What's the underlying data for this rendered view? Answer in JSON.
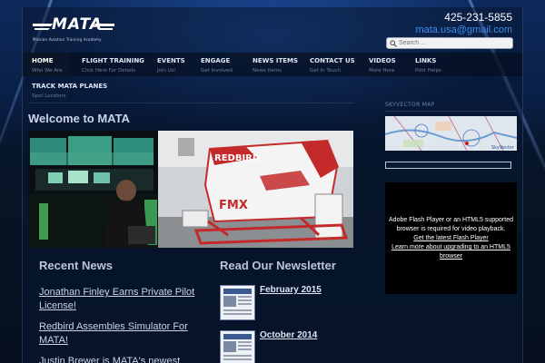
{
  "header": {
    "logo_text": "MATA",
    "logo_subtitle": "Mission Aviation Training Academy",
    "phone": "425-231-5855",
    "email": "mata.usa@gmail.com"
  },
  "search": {
    "placeholder": "Search ..."
  },
  "nav": {
    "items": [
      {
        "label": "HOME",
        "sub": "Who We Are",
        "active": true
      },
      {
        "label": "FLIGHT TRAINING",
        "sub": "Click Here For Details"
      },
      {
        "label": "EVENTS",
        "sub": "Join Us!"
      },
      {
        "label": "ENGAGE",
        "sub": "Get Involved"
      },
      {
        "label": "NEWS ITEMS",
        "sub": "News Items"
      },
      {
        "label": "CONTACT US",
        "sub": "Get In Touch"
      },
      {
        "label": "VIDEOS",
        "sub": "More Here"
      },
      {
        "label": "LINKS",
        "sub": "Pilot Helps"
      },
      {
        "label": "TRACK MATA PLANES",
        "sub": "Spot Locators"
      }
    ]
  },
  "main": {
    "welcome": "Welcome to MATA",
    "hero_brand": "REDBIRD",
    "hero_model": "FMX"
  },
  "news": {
    "heading": "Recent News",
    "items": [
      "Jonathan Finley Earns Private Pilot License!",
      "Redbird Assembles Simulator For MATA!",
      "Justin Brewer is MATA's newest"
    ]
  },
  "newsletter": {
    "heading": "Read Our Newsletter",
    "issues": [
      "February 2015",
      "October 2014"
    ]
  },
  "sidebar": {
    "skyvector_heading": "SKYVECTOR MAP",
    "map_brand": "SkyVector",
    "player_text": "Adobe Flash Player or an HTML5 supported browser is required for video playback.",
    "player_link1": "Get the latest Flash Player",
    "player_link2": "Learn more about upgrading to an HTML5 browser"
  }
}
